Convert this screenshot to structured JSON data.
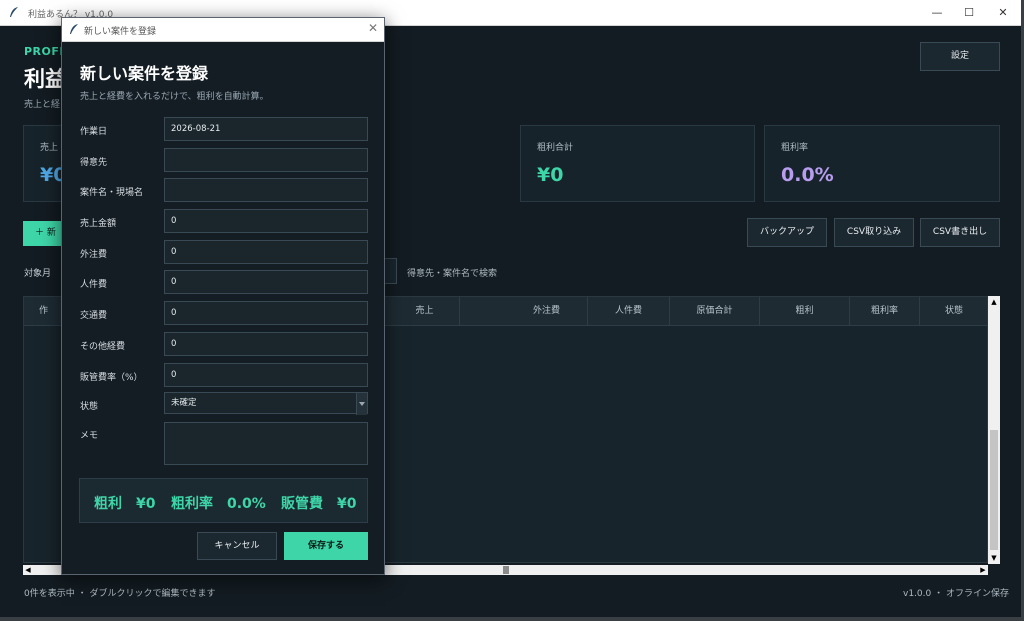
{
  "main": {
    "title": "利益あるん？ v1.0.0",
    "window_controls": {
      "minimize": "—",
      "maximize": "☐",
      "close": "✕"
    },
    "brand": "PROFIT",
    "app_title": "利益",
    "subtitle": "売上と経",
    "settings_label": "設定",
    "cards": [
      {
        "label": "売上",
        "value": "¥0",
        "color": "#4fa8e8"
      },
      {
        "label": "粗利合計",
        "value": "¥0",
        "color": "#3ed6a8"
      },
      {
        "label": "粗利率",
        "value": "0.0%",
        "color": "#b79cf0"
      }
    ],
    "new_button": "＋ 新",
    "actions": {
      "backup": "バックアップ",
      "csv_import": "CSV取り込み",
      "csv_export": "CSV書き出し"
    },
    "month_label": "対象月",
    "search_hint": "得意先・案件名で検索",
    "table_headers": [
      "作",
      "売上",
      "外注費",
      "人件費",
      "原価合計",
      "粗利",
      "粗利率",
      "状態"
    ],
    "footer_left": "0件を表示中 ・ ダブルクリックで編集できます",
    "footer_right": "v1.0.0 ・ オフライン保存"
  },
  "dialog": {
    "titlebar": "新しい案件を登録",
    "close_glyph": "✕",
    "heading": "新しい案件を登録",
    "description": "売上と経費を入れるだけで、粗利を自動計算。",
    "fields": [
      {
        "label": "作業日",
        "value": "2026-08-21"
      },
      {
        "label": "得意先",
        "value": ""
      },
      {
        "label": "案件名・現場名",
        "value": ""
      },
      {
        "label": "売上金額",
        "value": "0"
      },
      {
        "label": "外注費",
        "value": "0"
      },
      {
        "label": "人件費",
        "value": "0"
      },
      {
        "label": "交通費",
        "value": "0"
      },
      {
        "label": "その他経費",
        "value": "0"
      },
      {
        "label": "販管費率（%）",
        "value": "0"
      }
    ],
    "status": {
      "label": "状態",
      "value": "未確定"
    },
    "memo": {
      "label": "メモ",
      "value": ""
    },
    "summary": {
      "gross_profit": "粗利　¥0",
      "gross_margin": "粗利率　0.0%",
      "sga": "販管費　¥0"
    },
    "cancel_label": "キャンセル",
    "save_label": "保存する"
  },
  "colors": {
    "accent": "#3ed6a8",
    "background": "#131c22",
    "panel": "#17232a"
  }
}
